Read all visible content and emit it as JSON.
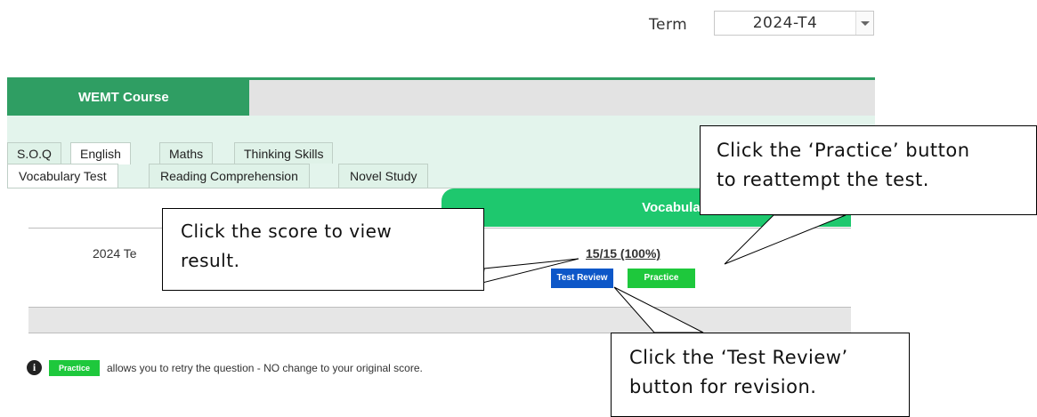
{
  "term": {
    "label": "Term",
    "value": "2024-T4"
  },
  "course": {
    "title": "WEMT Course"
  },
  "subject_tabs": [
    {
      "label": "S.O.Q"
    },
    {
      "label": "English"
    },
    {
      "label": "Maths"
    },
    {
      "label": "Thinking Skills"
    }
  ],
  "sub_tabs": [
    {
      "label": "Vocabulary Test"
    },
    {
      "label": "Reading Comprehension"
    },
    {
      "label": "Novel Study"
    }
  ],
  "table": {
    "column_header": "Vocabulary",
    "row_label": "2024 Te",
    "score": "15/15 (100%)",
    "test_review_button": "Test Review",
    "practice_button": "Practice"
  },
  "note": {
    "badge": "Practice",
    "text": "allows you to retry the question - NO change to your original score."
  },
  "callouts": {
    "score": {
      "line1": "Click the score to view",
      "line2": "result."
    },
    "practice": {
      "line1": "Click the ‘Practice’ button",
      "line2": "to reattempt the test."
    },
    "review": {
      "line1": "Click the ‘Test Review’",
      "line2": "button for revision."
    }
  },
  "colors": {
    "course_green": "#2f9e63",
    "panel_bg": "#e3f4ec",
    "header_green": "#1ec86e",
    "practice_green": "#1ec83c",
    "review_blue": "#0d57c8"
  },
  "icons": {
    "info": "info-circle-icon",
    "dropdown": "chevron-down-icon"
  }
}
